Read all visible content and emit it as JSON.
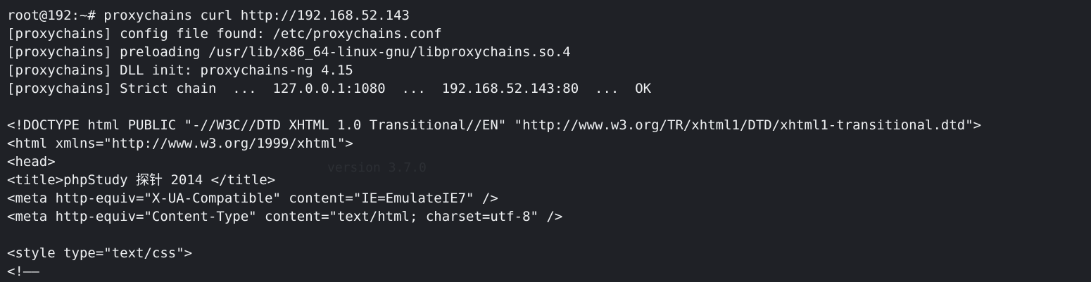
{
  "terminal": {
    "prompt_line": "root@192:~# proxychains curl http://192.168.52.143",
    "proxy_lines": [
      "[proxychains] config file found: /etc/proxychains.conf",
      "[proxychains] preloading /usr/lib/x86_64-linux-gnu/libproxychains.so.4",
      "[proxychains] DLL init: proxychains-ng 4.15",
      "[proxychains] Strict chain  ...  127.0.0.1:1080  ...  192.168.52.143:80  ...  OK"
    ],
    "html_lines": [
      "<!DOCTYPE html PUBLIC \"-//W3C//DTD XHTML 1.0 Transitional//EN\" \"http://www.w3.org/TR/xhtml1/DTD/xhtml1-transitional.dtd\">",
      "<html xmlns=\"http://www.w3.org/1999/xhtml\">",
      "<head>",
      "<title>phpStudy 探针 2014 </title>",
      "<meta http-equiv=\"X-UA-Compatible\" content=\"IE=EmulateIE7\" />",
      "<meta http-equiv=\"Content-Type\" content=\"text/html; charset=utf-8\" />"
    ],
    "style_line": "<style type=\"text/css\">",
    "last_line": "<!——"
  },
  "watermark": {
    "version": "version 3.7.0"
  }
}
